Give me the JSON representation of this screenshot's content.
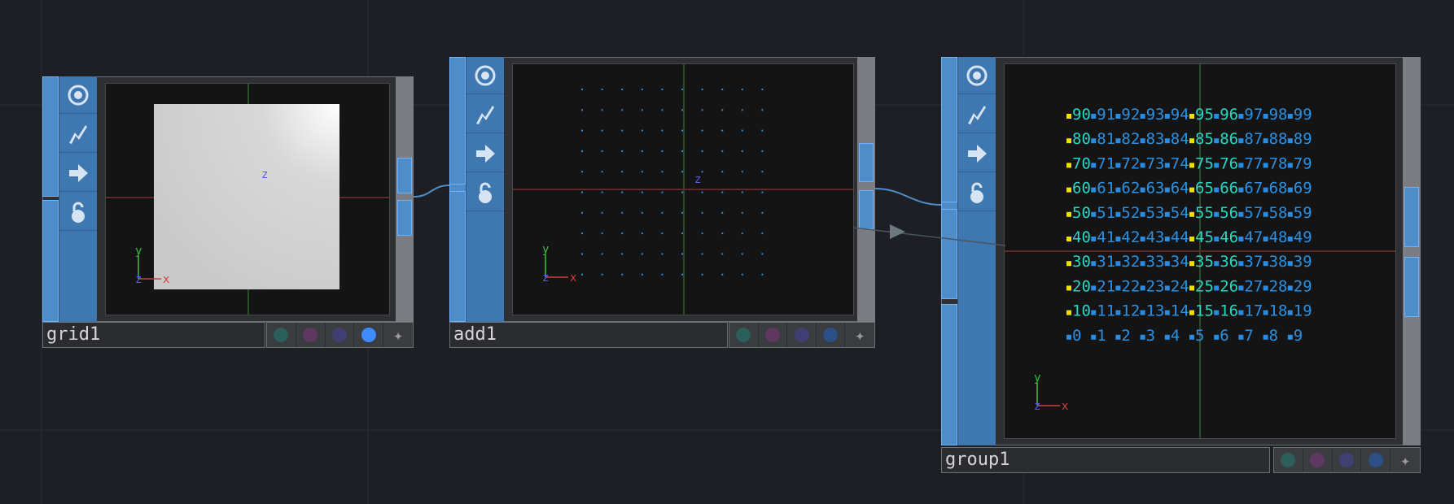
{
  "nodes": [
    {
      "name": "grid1"
    },
    {
      "name": "add1"
    },
    {
      "name": "group1"
    }
  ],
  "flag_colors": [
    "#2f6b64",
    "#6a3a68",
    "#4a467e",
    "#3d8bff",
    "#9a9a9a"
  ],
  "flag_colors_off": [
    "#2c5e5a",
    "#5e3860",
    "#403f72",
    "#2c4f86",
    "#9a9a9a"
  ],
  "icons": [
    "eye-icon",
    "lightning-icon",
    "arrow-right-icon",
    "lock-icon"
  ],
  "viewer_axis": {
    "y": "y",
    "z": "z",
    "x": "x"
  },
  "group1_labels": {
    "rows": [
      [
        "90",
        "91",
        "92",
        "93",
        "94",
        "95",
        "96",
        "97",
        "98",
        "99"
      ],
      [
        "80",
        "81",
        "82",
        "83",
        "84",
        "85",
        "86",
        "87",
        "88",
        "89"
      ],
      [
        "70",
        "71",
        "72",
        "73",
        "74",
        "75",
        "76",
        "77",
        "78",
        "79"
      ],
      [
        "60",
        "61",
        "62",
        "63",
        "64",
        "65",
        "66",
        "67",
        "68",
        "69"
      ],
      [
        "50",
        "51",
        "52",
        "53",
        "54",
        "55",
        "56",
        "57",
        "58",
        "59"
      ],
      [
        "40",
        "41",
        "42",
        "43",
        "44",
        "45",
        "46",
        "47",
        "48",
        "49"
      ],
      [
        "30",
        "31",
        "32",
        "33",
        "34",
        "35",
        "36",
        "37",
        "38",
        "39"
      ],
      [
        "20",
        "21",
        "22",
        "23",
        "24",
        "25",
        "26",
        "27",
        "28",
        "29"
      ],
      [
        "10",
        "11",
        "12",
        "13",
        "14",
        "15",
        "16",
        "17",
        "18",
        "19"
      ],
      [
        "0",
        "1",
        "2",
        "3",
        "4",
        "5",
        "6",
        "7",
        "8",
        "9"
      ]
    ],
    "highlight_cols": [
      0,
      5,
      6
    ],
    "highlight_color": "#27d6c4",
    "normal_color": "#2a90e2",
    "point_color_yellow": "#f0e000",
    "point_color_blue": "#2a8be0"
  }
}
